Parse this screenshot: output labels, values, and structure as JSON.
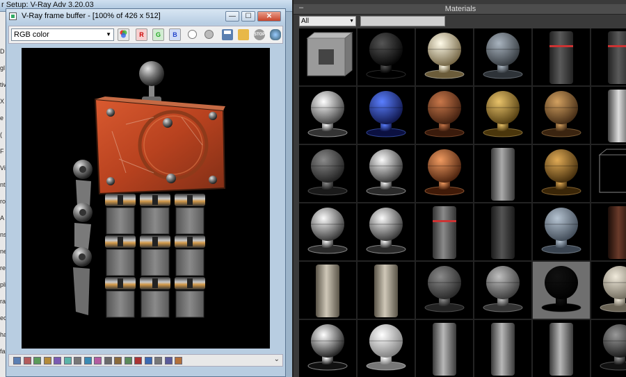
{
  "background_window": {
    "title": "r Setup: V-Ray Adv 3.20.03",
    "side_letters": [
      "D",
      "gl",
      "tiv",
      "X",
      "e",
      "(",
      "F",
      "Vir",
      "nt",
      "ro",
      "A",
      "ns",
      "ne",
      "rec",
      "pli",
      "ra",
      "ec",
      "ha",
      "fa"
    ]
  },
  "vfb": {
    "title": "V-Ray frame buffer - [100% of 426 x 512]",
    "channel": "RGB color",
    "buttons": {
      "red": "R",
      "green": "G",
      "blue": "B",
      "stop": "STOP"
    },
    "window_buttons": {
      "minimize": "—",
      "maximize": "☐",
      "close": "✕"
    },
    "status_chevron": "⌄"
  },
  "materials": {
    "panel_title": "Materials",
    "collapse_label": "–",
    "filter_value": "All",
    "search_value": "",
    "thumbnails": [
      [
        "box-concrete",
        "sphere-black-gloss",
        "sphere-glow-white",
        "sphere-gray-matte",
        "cylinder-stripe-dark",
        "cylinder-stripe-dark"
      ],
      [
        "sphere-clear-glass",
        "sphere-blue-glass",
        "sphere-rusty-copper",
        "sphere-brass",
        "sphere-bronze",
        "cylinder-chrome"
      ],
      [
        "sphere-dark-rough",
        "sphere-chrome",
        "sphere-copper",
        "cylinder-steel",
        "sphere-gold-rough",
        "box-wire-mesh"
      ],
      [
        "sphere-chrome",
        "sphere-chrome",
        "cylinder-stripe-gray",
        "cylinder-dark-metal",
        "sphere-gray-blue",
        "cylinder-rust-dark"
      ],
      [
        "cylinder-beige",
        "cylinder-beige",
        "sphere-dark-gray",
        "sphere-gray",
        "sphere-black-shadow",
        "sphere-cream"
      ],
      [
        "sphere-mirror",
        "sphere-white",
        "cylinder-brushed",
        "cylinder-brushed",
        "cylinder-brushed",
        "sphere-wire"
      ]
    ],
    "selected": {
      "row": 4,
      "col": 4
    }
  },
  "colors": {
    "accent_red": "#c84a2a",
    "panel_bg": "#3a3a3a",
    "window_chrome": "#b8cde1"
  }
}
